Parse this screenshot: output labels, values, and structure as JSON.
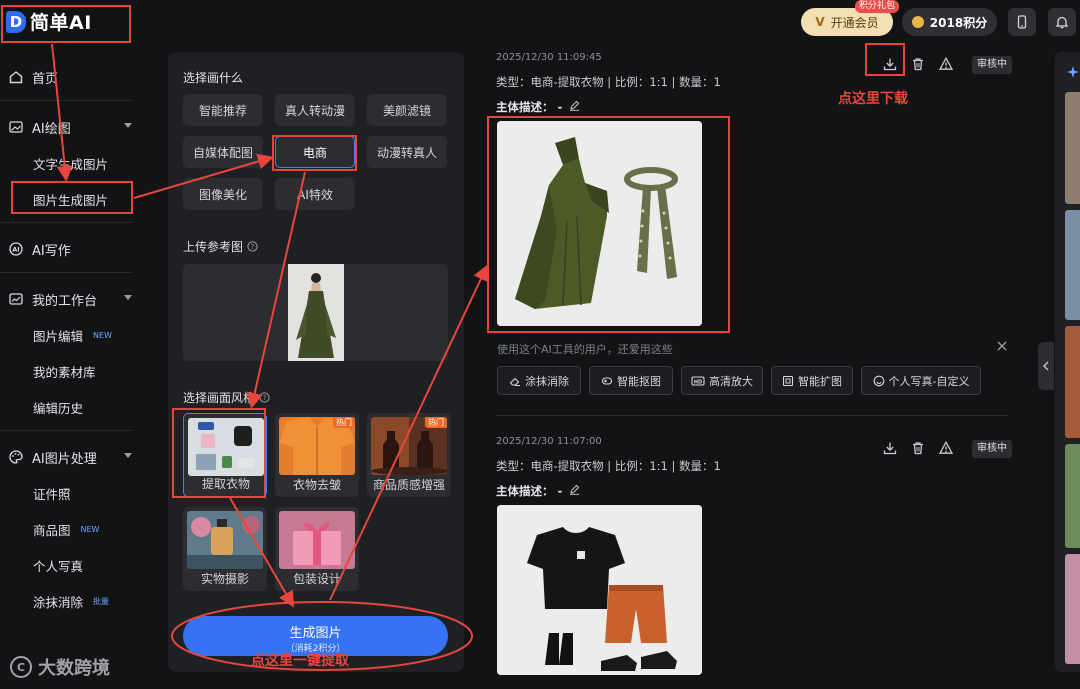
{
  "app": {
    "logo_mark": "D",
    "logo_text": "简单AI"
  },
  "header": {
    "vip_label": "开通会员",
    "vip_mark": "V",
    "gift_badge": "积分礼包",
    "points": "2018积分"
  },
  "sidebar": {
    "items": [
      {
        "label": "首页",
        "icon": "home-icon"
      },
      {
        "label": "AI绘图",
        "icon": "image-icon"
      },
      {
        "label": "文字生成图片"
      },
      {
        "label": "图片生成图片"
      },
      {
        "label": "AI写作",
        "icon": "ai-write-icon"
      },
      {
        "label": "我的工作台",
        "icon": "chart-icon"
      },
      {
        "label": "图片编辑",
        "badge": "NEW"
      },
      {
        "label": "我的素材库"
      },
      {
        "label": "编辑历史"
      },
      {
        "label": "AI图片处理",
        "icon": "palette-icon"
      },
      {
        "label": "证件照"
      },
      {
        "label": "商品图",
        "badge": "NEW"
      },
      {
        "label": "个人写真"
      },
      {
        "label": "涂抹消除",
        "badge": "批量"
      }
    ]
  },
  "panel": {
    "what_title": "选择画什么",
    "types": [
      "智能推荐",
      "真人转动漫",
      "美颜滤镜",
      "自媒体配图",
      "电商",
      "动漫转真人",
      "图像美化",
      "AI特效"
    ],
    "upload_title": "上传参考图",
    "style_title": "选择画面风格",
    "styles": [
      {
        "label": "提取衣物",
        "hot": ""
      },
      {
        "label": "衣物去皱",
        "hot": "热门"
      },
      {
        "label": "商品质感增强",
        "hot": "热门"
      },
      {
        "label": "实物摄影",
        "hot": ""
      },
      {
        "label": "包装设计",
        "hot": ""
      }
    ],
    "generate_label": "生成图片",
    "generate_cost": "（消耗2积分）"
  },
  "results": [
    {
      "time": "2025/12/30 11:09:45",
      "meta": "类型：电商-提取衣物 | 比例：1:1 | 数量：1",
      "desc_label": "主体描述：",
      "desc_value": "-",
      "status": "审核中"
    },
    {
      "time": "2025/12/30 11:07:00",
      "meta": "类型：电商-提取衣物 | 比例：1:1 | 数量：1",
      "desc_label": "主体描述：",
      "desc_value": "-",
      "status": "审核中"
    }
  ],
  "suggest": {
    "title": "使用这个AI工具的用户，还爱用这些",
    "tools": [
      "涂抹消除",
      "智能抠图",
      "高清放大",
      "智能扩图",
      "个人写真-自定义"
    ]
  },
  "annotations": {
    "download": "点这里下载",
    "generate": "点这里一键提取"
  },
  "watermark": {
    "mark": "C",
    "text": "大数跨境"
  },
  "colors": {
    "accent": "#3573f4",
    "annotation": "#e8463c",
    "vip_gold": "#f3dfb4"
  }
}
